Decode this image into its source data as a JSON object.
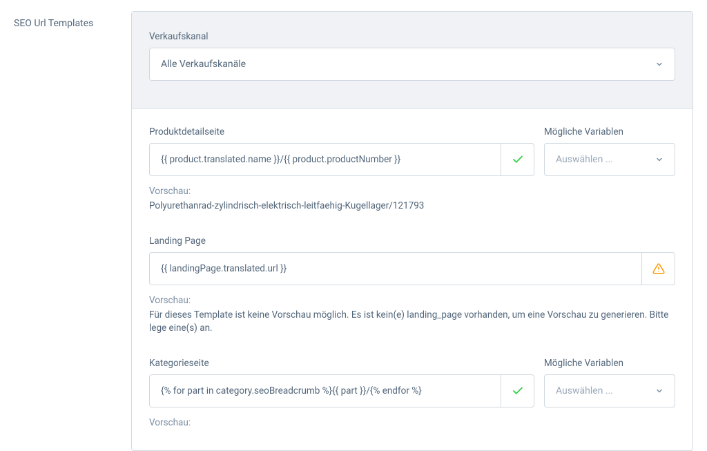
{
  "sidebar": {
    "title": "SEO Url Templates"
  },
  "salesChannel": {
    "label": "Verkaufskanal",
    "value": "Alle Verkaufskanäle"
  },
  "sections": [
    {
      "label": "Produktdetailseite",
      "value": "{{ product.translated.name }}/{{ product.productNumber }}",
      "status": "ok",
      "previewLabel": "Vorschau:",
      "previewText": "Polyurethanrad-zylindrisch-elektrisch-leitfaehig-Kugellager/121793",
      "variablesLabel": "Mögliche Variablen",
      "variablesPlaceholder": "Auswählen ..."
    },
    {
      "label": "Landing Page",
      "value": "{{ landingPage.translated.url }}",
      "status": "warn",
      "previewLabel": "Vorschau:",
      "previewText": "Für dieses Template ist keine Vorschau möglich. Es ist kein(e) landing_page vorhanden, um eine Vorschau zu generieren. Bitte lege eine(s) an.",
      "variablesLabel": "",
      "variablesPlaceholder": ""
    },
    {
      "label": "Kategorieseite",
      "value": "{% for part in category.seoBreadcrumb %}{{ part }}/{% endfor %}",
      "status": "ok",
      "previewLabel": "Vorschau:",
      "previewText": "",
      "variablesLabel": "Mögliche Variablen",
      "variablesPlaceholder": "Auswählen ..."
    }
  ]
}
